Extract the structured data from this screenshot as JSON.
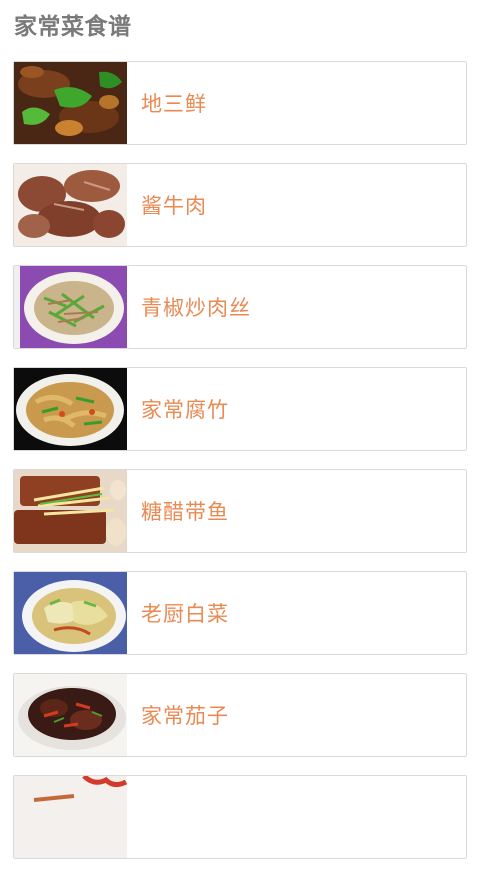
{
  "header": {
    "title": "家常菜食谱"
  },
  "recipes": [
    {
      "title": "地三鲜",
      "icon": "dish-thumbnail"
    },
    {
      "title": "酱牛肉",
      "icon": "dish-thumbnail"
    },
    {
      "title": "青椒炒肉丝",
      "icon": "dish-thumbnail"
    },
    {
      "title": "家常腐竹",
      "icon": "dish-thumbnail"
    },
    {
      "title": "糖醋带鱼",
      "icon": "dish-thumbnail"
    },
    {
      "title": "老厨白菜",
      "icon": "dish-thumbnail"
    },
    {
      "title": "家常茄子",
      "icon": "dish-thumbnail"
    },
    {
      "title": "",
      "icon": "dish-thumbnail"
    }
  ],
  "colors": {
    "title_text": "#7a7a7a",
    "item_text": "#e98a53",
    "card_border": "#d9d9d9"
  }
}
